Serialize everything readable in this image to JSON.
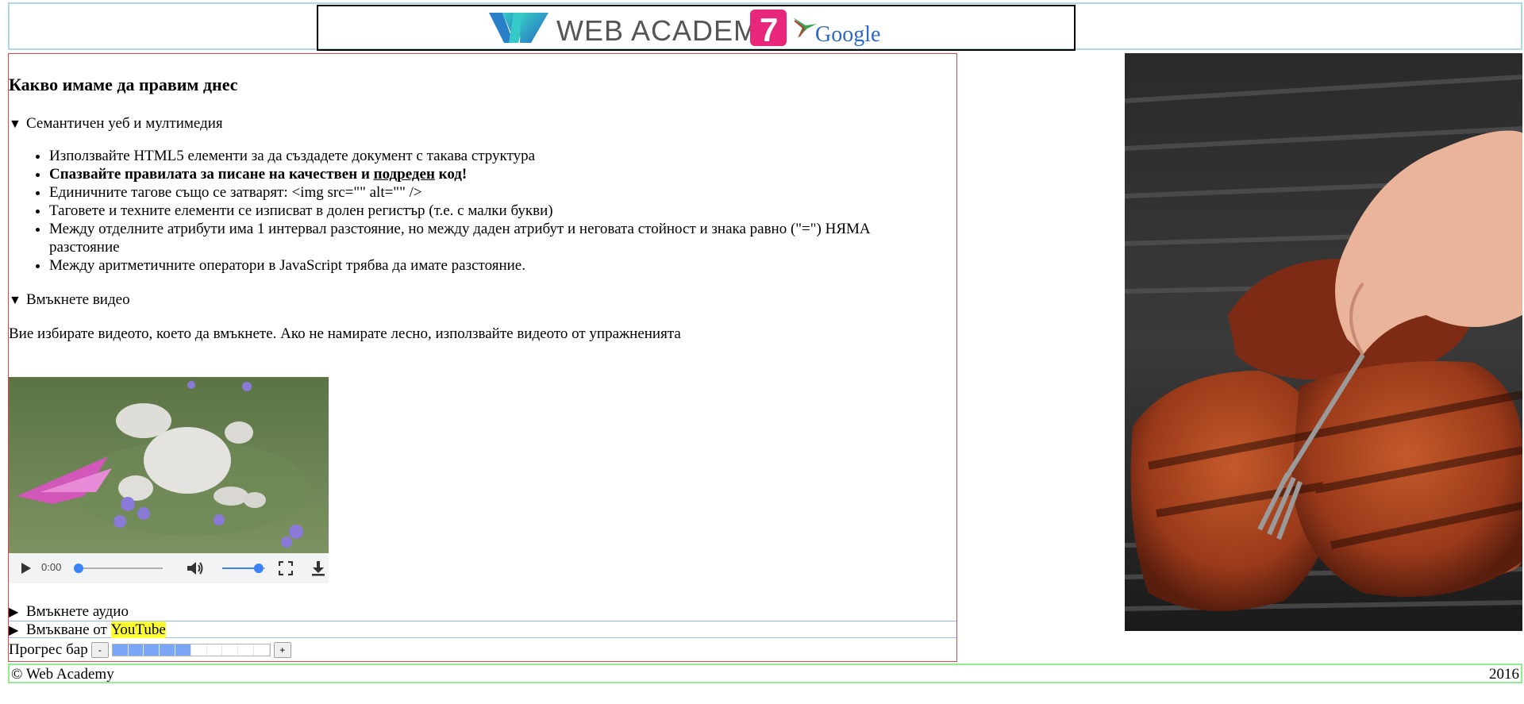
{
  "header": {
    "logo_text": "WEB ACADEMY",
    "badge_number": "7",
    "google_text": "Google",
    "colors": {
      "accent_pink": "#e8277a",
      "teal": "#2bc7c7",
      "blue": "#2e66c9"
    }
  },
  "main": {
    "title": "Какво имаме да правим днес",
    "section1": {
      "summary": "Семантичен уеб и мултимедия",
      "items": [
        "Използвайте HTML5 елементи за да създадете документ с такава структура",
        "Единичните тагове също се затварят: <img src=\"\" alt=\"\" />",
        "Таговете и техните елементи се изписват в долен регистър (т.е. с малки букви)",
        "Между отделните атрибути има 1 интервал разстояние, но между даден атрибут и неговата стойност и знака равно (\"=\") НЯМА разстояние",
        "Между аритметичните оператори в JavaScript трябва да имате разстояние."
      ],
      "bold_item": {
        "part1": "Спазвайте правилата за писане на качествен и",
        "underlined": "подреден",
        "part2": "код!"
      }
    },
    "section2": {
      "summary": "Вмъкнете видео",
      "text": "Вие избирате видеото, което да вмъкнете. Ако не намирате лесно, използвайте видеото от упражненията"
    },
    "video": {
      "time": "0:00",
      "progress": 0,
      "volume": 0.85
    },
    "audio_summary": "Вмъкнете аудио",
    "youtube": {
      "prefix": "Вмъкване от",
      "highlight": "YouTube"
    },
    "progress_bar": {
      "label": "Прогрес бар",
      "minus": "-",
      "plus": "+",
      "value": 0.5,
      "segments": 10
    }
  },
  "footer": {
    "copyright": "© Web Academy",
    "year": "2016"
  }
}
